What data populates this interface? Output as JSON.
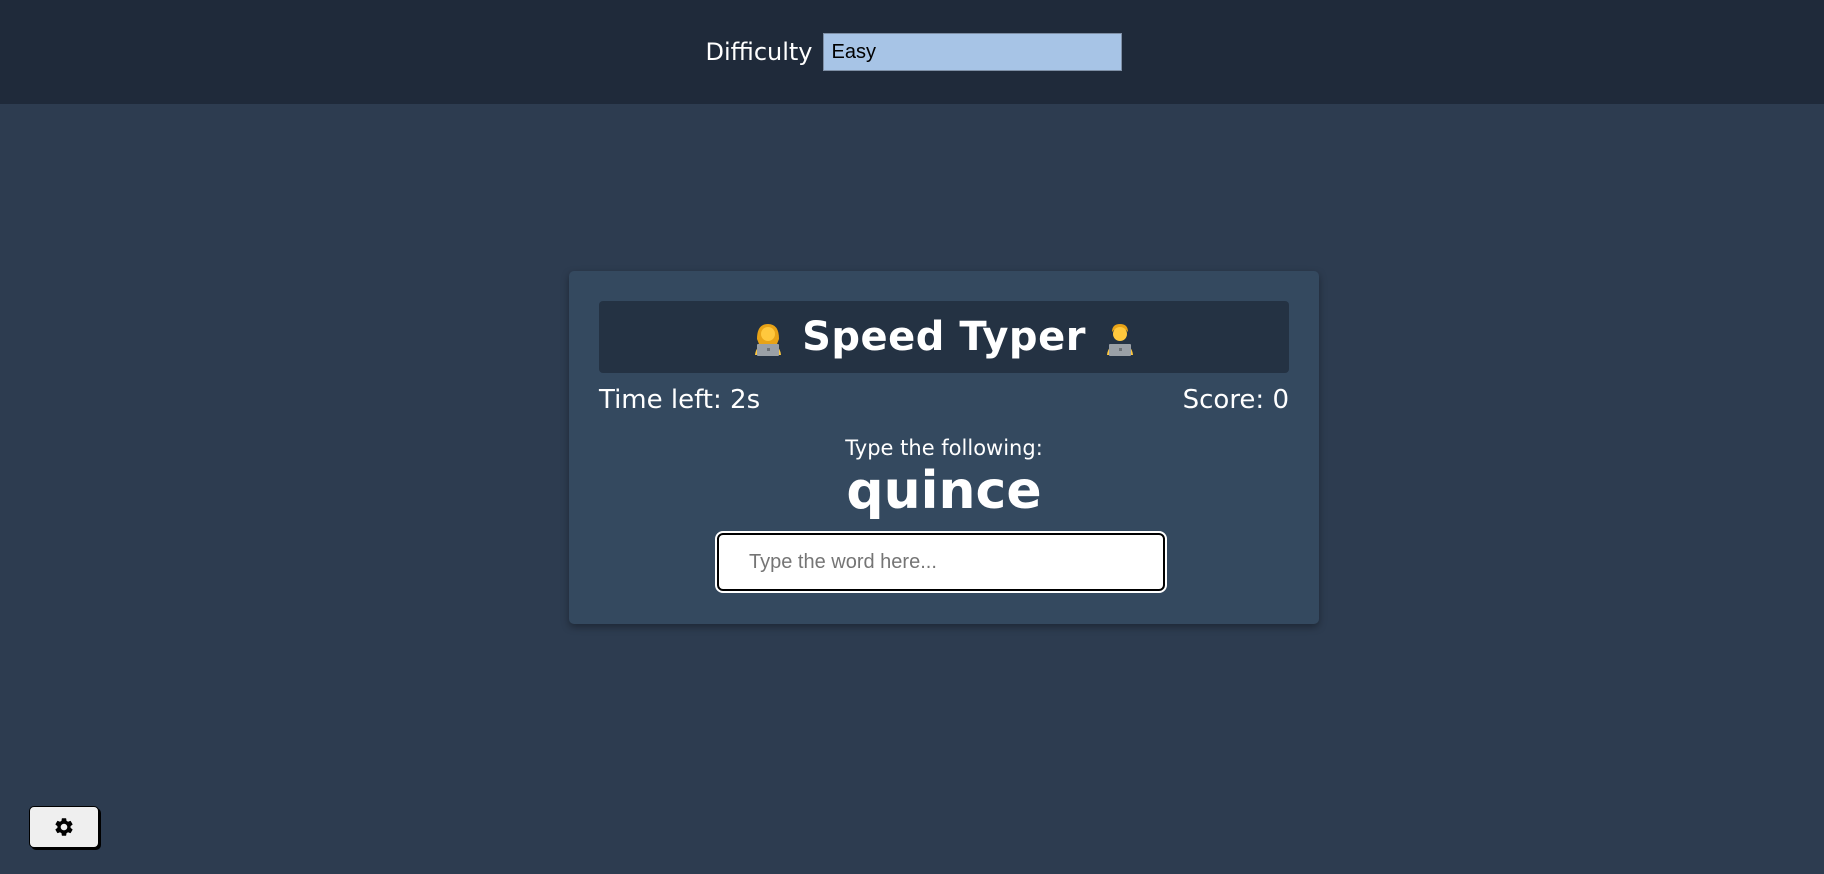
{
  "settings": {
    "difficulty_label": "Difficulty",
    "difficulty_value": "Easy",
    "difficulty_options": [
      "Easy"
    ]
  },
  "game": {
    "title": "Speed Typer",
    "title_icon_left": "woman-technologist-emoji",
    "title_icon_right": "man-technologist-emoji",
    "time_left": "Time left: 2s",
    "score": "Score: 0",
    "instruction": "Type the following:",
    "word": "quince",
    "input_placeholder": "Type the word here...",
    "input_value": ""
  },
  "controls": {
    "settings_button_icon": "gear-icon"
  },
  "colors": {
    "page_bg": "#2d3c50",
    "settings_bar_bg": "#1f2a3a",
    "card_bg": "#34495f",
    "title_bar_bg": "#243243",
    "select_bg": "#a7c4e6"
  }
}
